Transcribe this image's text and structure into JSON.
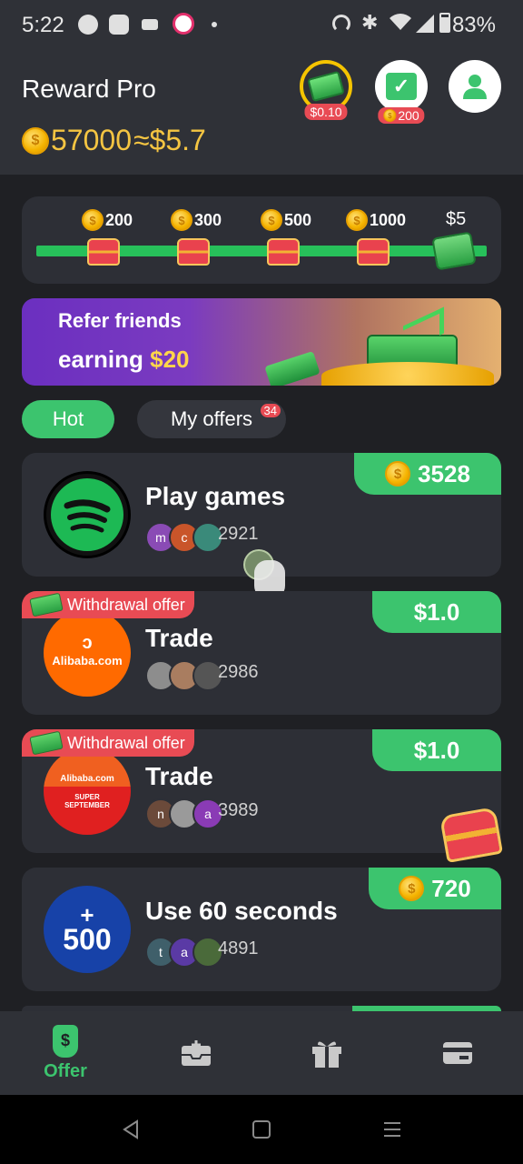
{
  "status_bar": {
    "time": "5:22",
    "battery": "83%"
  },
  "header": {
    "app_title": "Reward Pro",
    "balance_coins": "57000",
    "balance_approx": "≈$5.7",
    "cash_button_tag": "$0.10",
    "checkin_button_tag": "200"
  },
  "progress": {
    "milestones": [
      "200",
      "300",
      "500",
      "1000"
    ],
    "final_label": "$5"
  },
  "banner": {
    "line1": "Refer friends",
    "line2_prefix": "earning ",
    "line2_amount": "$20"
  },
  "tabs": {
    "hot": "Hot",
    "my_offers": "My offers",
    "my_offers_badge": "34"
  },
  "offers": [
    {
      "title": "Play games",
      "reward": "3528",
      "reward_type": "coins",
      "count": "2921",
      "tag": "",
      "logo": "spotify-logo-icon",
      "avatar_letters": [
        "m",
        "c",
        ""
      ]
    },
    {
      "title": "Trade",
      "reward": "$1.0",
      "reward_type": "cash",
      "count": "2986",
      "tag": "Withdrawal offer",
      "logo": "alibaba-logo-icon",
      "avatar_letters": [
        "",
        "",
        ""
      ]
    },
    {
      "title": "Trade",
      "reward": "$1.0",
      "reward_type": "cash",
      "count": "3989",
      "tag": "Withdrawal offer",
      "logo": "alibaba-super-september-logo-icon",
      "avatar_letters": [
        "n",
        "",
        "a"
      ]
    },
    {
      "title": "Use 60 seconds",
      "reward": "720",
      "reward_type": "coins",
      "count": "4891",
      "tag": "",
      "logo": "500-logo-icon",
      "avatar_letters": [
        "t",
        "a",
        ""
      ]
    }
  ],
  "alibaba": {
    "text": "Alibaba.com",
    "sub1": "Alibaba.com",
    "sub2": "SUPER",
    "sub3": "SEPTEMBER"
  },
  "logo500": {
    "plus": "+",
    "text": "500"
  },
  "nav": {
    "offer": "Offer"
  },
  "colors": {
    "accent_green": "#3cc46e",
    "badge_red": "#e84b54",
    "coin_gold": "#f5c542",
    "background": "#1f2024"
  }
}
